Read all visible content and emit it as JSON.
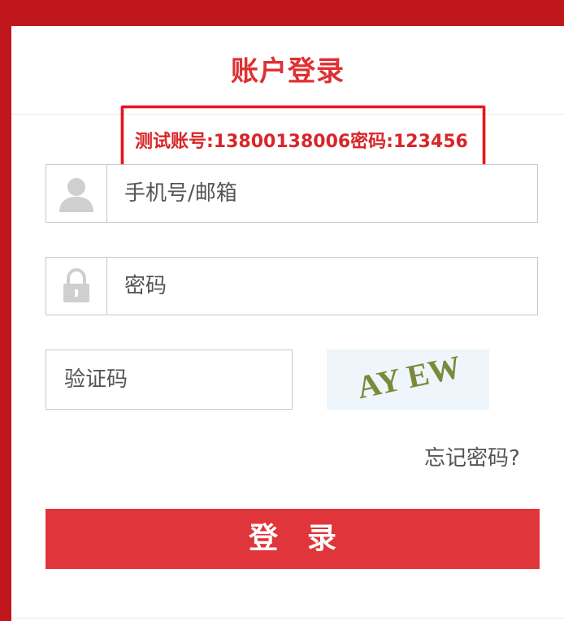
{
  "login": {
    "title": "账户登录",
    "notice": "测试账号:13800138006密码:123456",
    "account_field": {
      "placeholder": "手机号/邮箱",
      "icon": "user-icon"
    },
    "password_field": {
      "placeholder": "密码",
      "icon": "lock-icon"
    },
    "captcha_field": {
      "placeholder": "验证码"
    },
    "captcha_image": {
      "code": "AY EW"
    },
    "forgot_password": "忘记密码?",
    "submit_label": "登　录"
  },
  "colors": {
    "frame": "#c0171d",
    "title": "#df3033",
    "notice": "#d8262a",
    "button": "#e0353b",
    "captcha_text": "#7a8a3a"
  }
}
